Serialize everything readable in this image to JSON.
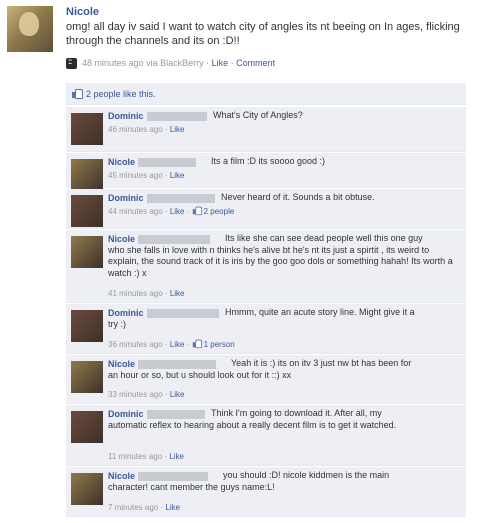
{
  "post": {
    "author": "Nicole",
    "text": "omg! all day iv said I want to watch city of angles its nt beeing on In ages, flicking through the channels and its on :D!!",
    "time": "48 minutes ago",
    "via": "via BlackBerry",
    "like_label": "Like",
    "comment_label": "Comment"
  },
  "likes": {
    "text": "2 people like this."
  },
  "comments": [
    {
      "author": "Dominic",
      "text": "What's City of Angles?",
      "time": "46 minutes ago",
      "like_label": "Like",
      "likes": ""
    },
    {
      "author": "Nicole",
      "text": "Its a film :D its soooo good :)",
      "time": "45 minutes ago",
      "like_label": "Like",
      "likes": ""
    },
    {
      "author": "Dominic",
      "text": "Never heard of it. Sounds a bit obtuse.",
      "time": "44 minutes ago",
      "like_label": "Like",
      "likes": "2 people"
    },
    {
      "author": "Nicole",
      "text_first": "Its like she can see dead people well this one guy",
      "text_rest": "who she falls in love with n thinks he's alive bt he's nt its just a spirtit , its weird to explain, the sound track of it is iris by the goo goo dols or something hahah! Its worth a watch :) x",
      "time": "41 minutes ago",
      "like_label": "Like",
      "likes": ""
    },
    {
      "author": "Dominic",
      "text_first": "Hmmm, quite an acute story line. Might give it a",
      "text_rest": "try :)",
      "time": "36 minutes ago",
      "like_label": "Like",
      "likes": "1 person"
    },
    {
      "author": "Nicole",
      "text_first": "Yeah it is :) its on itv 3 just nw bt has been for",
      "text_rest": "an hour or so, but u should look out for it ::) xx",
      "time": "33 minutes ago",
      "like_label": "Like",
      "likes": ""
    },
    {
      "author": "Dominic",
      "text_first": "Think I'm going to download it. After all, my",
      "text_rest": "automatic reflex to hearing about a really decent film is to get it watched.",
      "time": "11 minutes ago",
      "like_label": "Like",
      "likes": ""
    },
    {
      "author": "Nicole",
      "text_first": "you should :D! nicole kiddmen is the main",
      "text_rest": "character! cant member the guys name:L!",
      "time": "7 minutes ago",
      "like_label": "Like",
      "likes": ""
    }
  ],
  "colors": {
    "link": "#3b5998",
    "comment_bg": "#edeff4",
    "meta": "#999999"
  }
}
